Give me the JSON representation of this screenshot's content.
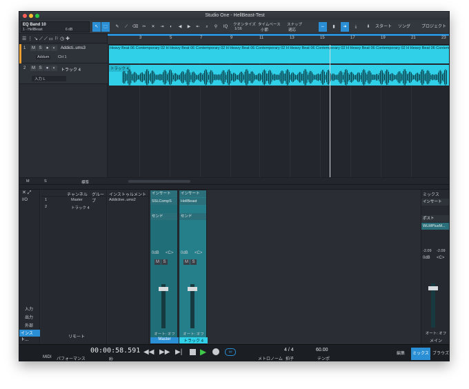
{
  "window": {
    "title": "Studio One - HellBeast-Test"
  },
  "toolbar": {
    "song_name": "EQ Band 10",
    "song_sub": "1 - HellBeast",
    "db_value": "6 dB",
    "quantize_label": "クオンタイズ",
    "quantize_value": "1/16",
    "timebase_label": "タイムベース",
    "timebase_value": "小節",
    "snap_label": "スナップ",
    "snap_value": "適応",
    "iq": "IQ",
    "start": "スタート",
    "song": "ソング",
    "project": "プロジェクト"
  },
  "ruler": {
    "ticks": [
      "3",
      "5",
      "7",
      "9",
      "11",
      "13",
      "15",
      "17",
      "19",
      "21",
      "23"
    ]
  },
  "tracks": [
    {
      "num": "1",
      "name": "Addicti..ums3",
      "sub": "Addum",
      "sub2": "CH 1"
    },
    {
      "num": "2",
      "name": "トラック 4",
      "sub": "入力 L",
      "sub2": ""
    }
  ],
  "clips": {
    "track1_text": "Heavy Beat 06 Contemporary 02 H Heavy Beat 06 Contemporary 02 H Heavy Beat 06 Contemporary 02 H Heavy Beat 06 Contemporary 02 H Heavy Beat 06 Contemporary 02 H Heavy Beat 06 Contemporary 02 H",
    "track2_label": "トラック 4"
  },
  "tracklist_footer": {
    "m": "M",
    "s": "S",
    "std": "標準"
  },
  "mixer": {
    "channel_tab": "チャンネル",
    "group_tab": "グループ",
    "instrument_tab": "インストゥルメント",
    "channels": [
      {
        "num": "1",
        "name": "Master"
      },
      {
        "num": "2",
        "name": "トラック 4"
      }
    ],
    "instrument_item": "Addictive..ums2",
    "left_buttons": [
      "I/O",
      "入力",
      "出力",
      "外部",
      "インスト..."
    ],
    "remote": "リモート",
    "strip1": {
      "insert": "インサート",
      "plugin": "SSLCompS",
      "send": "センド",
      "db": "0dB",
      "pan": "<C>",
      "auto": "オート: オフ",
      "name": "Master"
    },
    "strip2": {
      "insert": "インサート",
      "plugin": "HellBeast",
      "send": "センド",
      "db": "0dB",
      "pan": "<C>",
      "auto": "オート: オフ",
      "name": "トラック 4"
    },
    "main": {
      "mix": "ミックス",
      "insert": "インサート",
      "post": "ポスト",
      "post_plugin": "WLMPlusM...",
      "db_l": "-2.09",
      "db_r": "-2.09",
      "db": "0dB",
      "pan": "<C>",
      "auto": "オート: オフ",
      "name": "メイン"
    }
  },
  "transport": {
    "time": "00:00:58.591",
    "time_unit": "秒",
    "midi": "MIDI",
    "performance": "パフォーマンス",
    "metronome": "メトロノーム",
    "signature": "4 / 4",
    "sig_label": "拍子",
    "tempo": "60.00",
    "tempo_label": "テンポ",
    "edit_tab": "編集",
    "mix_tab": "ミックス",
    "browse_tab": "ブラウズ"
  },
  "colors": {
    "accent": "#2fd0e8",
    "select": "#2b8fd6",
    "strip": "#1f6e78"
  }
}
